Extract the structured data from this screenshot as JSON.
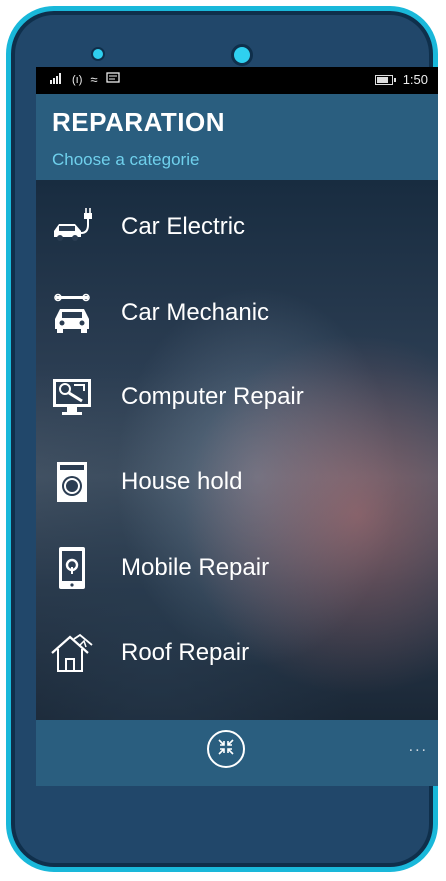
{
  "statusbar": {
    "time": "1:50"
  },
  "header": {
    "title": "REPARATION",
    "subtitle": "Choose a categorie"
  },
  "categories": [
    {
      "label": "Car Electric",
      "icon": "car-electric-icon"
    },
    {
      "label": "Car Mechanic",
      "icon": "car-mechanic-icon"
    },
    {
      "label": "Computer Repair",
      "icon": "computer-repair-icon"
    },
    {
      "label": "House hold",
      "icon": "washing-machine-icon"
    },
    {
      "label": "Mobile Repair",
      "icon": "mobile-repair-icon"
    },
    {
      "label": "Roof Repair",
      "icon": "house-roof-icon"
    }
  ],
  "appbar": {
    "more": "..."
  },
  "colors": {
    "frame": "#19b8da",
    "phone_body": "#21476a",
    "header": "#2a5e7f",
    "subtitle": "#6fd0ec"
  }
}
